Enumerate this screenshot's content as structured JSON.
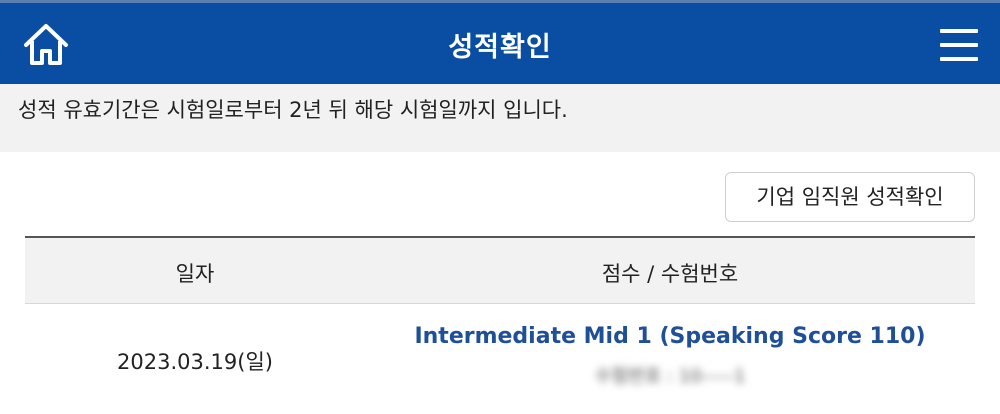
{
  "header": {
    "title": "성적확인",
    "home_icon": "home-icon",
    "menu_icon": "hamburger-menu-icon",
    "background": "#0a4ea3"
  },
  "notice": {
    "text": "성적 유효기간은 시험일로부터 2년 뒤 해당 시험일까지 입니다."
  },
  "corporate_button": {
    "label": "기업 임직원 성적확인"
  },
  "table": {
    "headers": [
      "일자",
      "점수 / 수험번호"
    ],
    "rows": [
      {
        "date": "2023.03.19(일)",
        "score": "Intermediate Mid 1 (Speaking Score 110)",
        "exam_number": "수험번호 : 10-----1"
      }
    ]
  }
}
